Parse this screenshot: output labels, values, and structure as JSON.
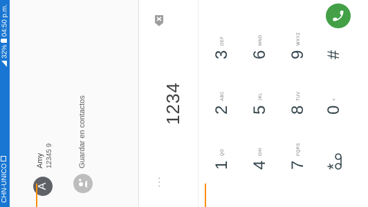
{
  "status_bar": {
    "carrier": "CHN-UNICO",
    "battery": "32%",
    "time": "04:50 p.m."
  },
  "suggestion": {
    "avatar_letter": "A",
    "name": "Amy",
    "number": "12345 9"
  },
  "save_contact_label": "Guardar en contactos",
  "dialer": {
    "display_number": "1234",
    "more_icon": "more-dots-icon",
    "keys": [
      {
        "digit": "1",
        "letters": "QO"
      },
      {
        "digit": "2",
        "letters": "ABC"
      },
      {
        "digit": "3",
        "letters": "DEF"
      },
      {
        "digit": "4",
        "letters": "GHI"
      },
      {
        "digit": "5",
        "letters": "JKL"
      },
      {
        "digit": "6",
        "letters": "MNO"
      },
      {
        "digit": "7",
        "letters": "PQRS"
      },
      {
        "digit": "8",
        "letters": "TUV"
      },
      {
        "digit": "9",
        "letters": "WXYZ"
      },
      {
        "digit": "*",
        "letters": ""
      },
      {
        "digit": "0",
        "letters": "+"
      },
      {
        "digit": "#",
        "letters": ""
      }
    ],
    "voicemail_icon": "voicemail-icon",
    "call_icon": "phone-icon"
  },
  "colors": {
    "status_bar": "#1976d2",
    "call_button": "#43a047",
    "callout": "#ff8f00"
  }
}
